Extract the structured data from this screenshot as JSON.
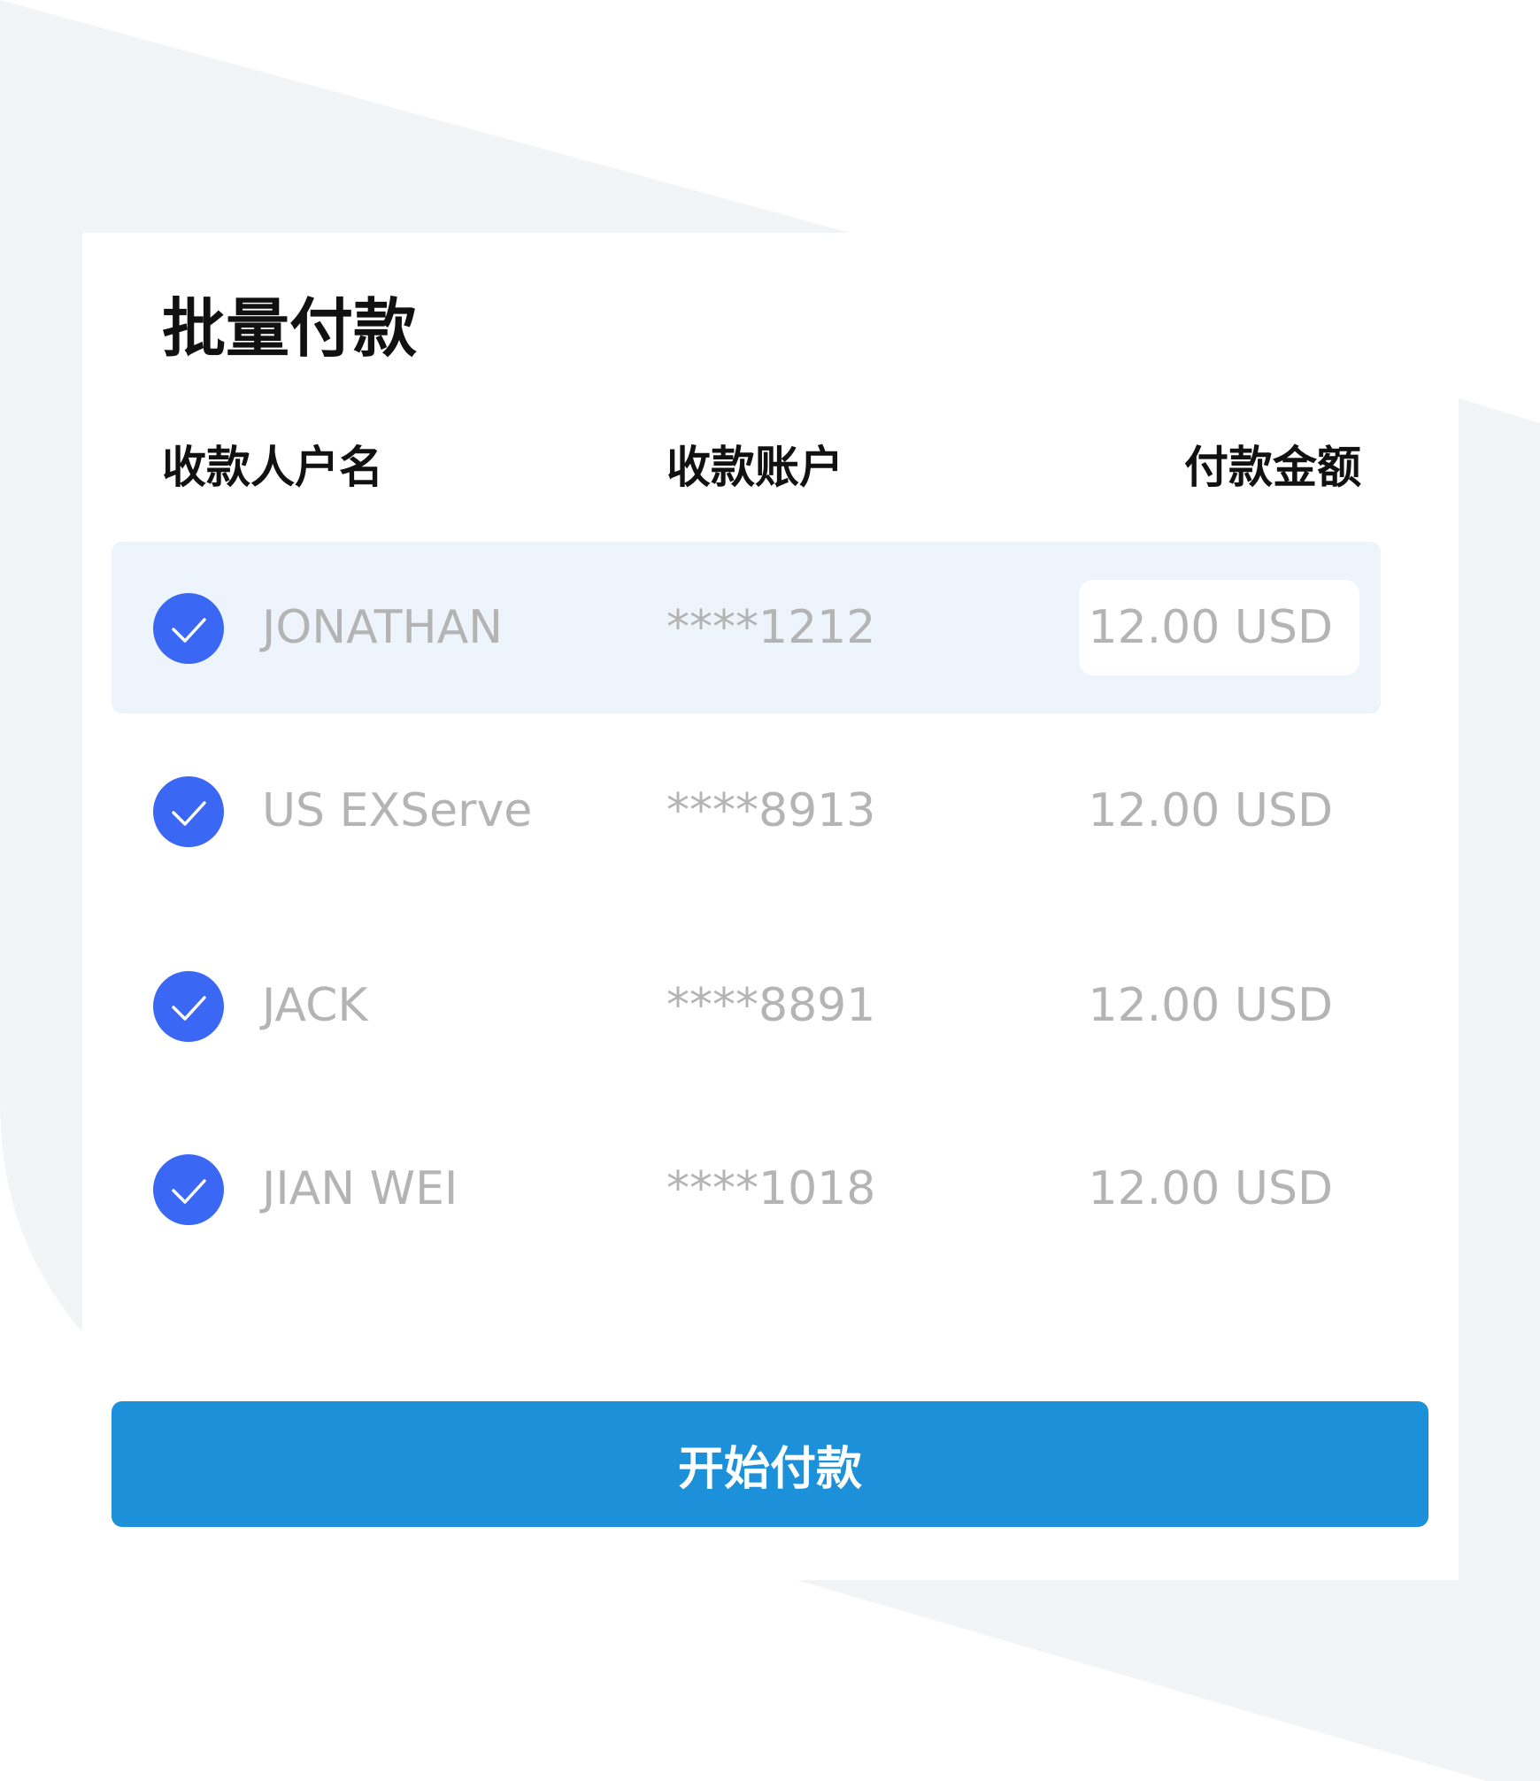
{
  "page": {
    "title": "批量付款"
  },
  "columns": {
    "name": "收款人户名",
    "account": "收款账户",
    "amount": "付款金额"
  },
  "rows": [
    {
      "name": "JONATHAN",
      "account": "****1212",
      "amount": "12.00 USD",
      "checked": true,
      "selected": true
    },
    {
      "name": "US EXServe",
      "account": "****8913",
      "amount": "12.00 USD",
      "checked": true,
      "selected": false
    },
    {
      "name": "JACK",
      "account": "****8891",
      "amount": "12.00 USD",
      "checked": true,
      "selected": false
    },
    {
      "name": "JIAN WEI",
      "account": "****1018",
      "amount": "12.00 USD",
      "checked": true,
      "selected": false
    }
  ],
  "actions": {
    "pay_label": "开始付款"
  },
  "colors": {
    "accent_check": "#3a67f4",
    "button": "#1c90d9",
    "selected_row": "#edf4fb",
    "muted_text": "#b4b4b4",
    "background_shape": "#f3f4f6"
  },
  "icons": {
    "checkbox": "check-circle-icon"
  }
}
